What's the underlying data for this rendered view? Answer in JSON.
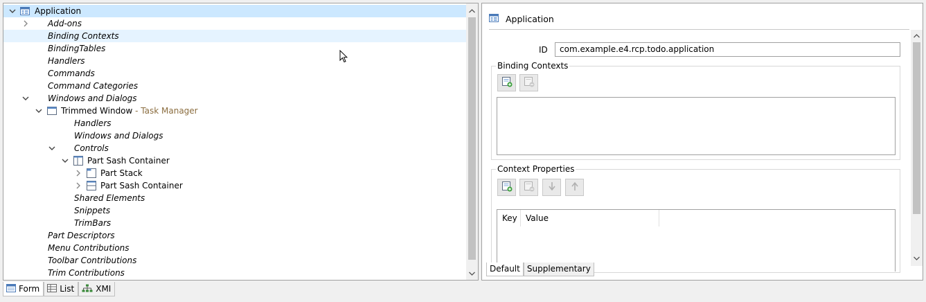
{
  "tree": {
    "rows": [
      {
        "label": "Application",
        "suffix": ""
      },
      {
        "label": "Add-ons",
        "suffix": ""
      },
      {
        "label": "Binding Contexts",
        "suffix": ""
      },
      {
        "label": "BindingTables",
        "suffix": ""
      },
      {
        "label": "Handlers",
        "suffix": ""
      },
      {
        "label": "Commands",
        "suffix": ""
      },
      {
        "label": "Command Categories",
        "suffix": ""
      },
      {
        "label": "Windows and Dialogs",
        "suffix": ""
      },
      {
        "label": "Trimmed Window",
        "suffix": " - Task Manager"
      },
      {
        "label": "Handlers",
        "suffix": ""
      },
      {
        "label": "Windows and Dialogs",
        "suffix": ""
      },
      {
        "label": "Controls",
        "suffix": ""
      },
      {
        "label": "Part Sash Container",
        "suffix": ""
      },
      {
        "label": "Part Stack",
        "suffix": ""
      },
      {
        "label": "Part Sash Container",
        "suffix": ""
      },
      {
        "label": "Shared Elements",
        "suffix": ""
      },
      {
        "label": "Snippets",
        "suffix": ""
      },
      {
        "label": "TrimBars",
        "suffix": ""
      },
      {
        "label": "Part Descriptors",
        "suffix": ""
      },
      {
        "label": "Menu Contributions",
        "suffix": ""
      },
      {
        "label": "Toolbar Contributions",
        "suffix": ""
      },
      {
        "label": "Trim Contributions",
        "suffix": ""
      }
    ]
  },
  "bottom_tabs": [
    {
      "label": "Form",
      "icon": "form-icon"
    },
    {
      "label": "List",
      "icon": "table-icon"
    },
    {
      "label": "XMI",
      "icon": "tree-icon"
    }
  ],
  "form": {
    "title": "Application",
    "id_label": "ID",
    "id_value": "com.example.e4.rcp.todo.application",
    "binding_contexts": {
      "title": "Binding Contexts"
    },
    "context_properties": {
      "title": "Context Properties",
      "columns": [
        "Key",
        "Value"
      ]
    },
    "tabs": [
      "Default",
      "Supplementary"
    ]
  },
  "colors": {
    "selection": "#cce8ff",
    "hover": "#e5f3ff",
    "suffix": "#8b6d3f"
  }
}
